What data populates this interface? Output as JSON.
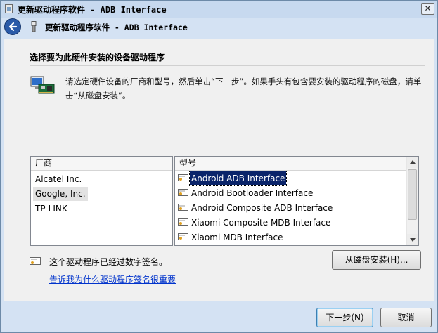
{
  "window": {
    "title": "更新驱动程序软件 - ADB Interface",
    "close_label": "✕"
  },
  "header": {
    "title": "更新驱动程序软件 - ADB Interface"
  },
  "content": {
    "heading": "选择要为此硬件安装的设备驱动程序",
    "instruction": "请选定硬件设备的厂商和型号，然后单击“下一步”。如果手头有包含要安装的驱动程序的磁盘，请单击“从磁盘安装”。"
  },
  "vendors": {
    "header": "厂商",
    "items": [
      "Alcatel Inc.",
      "Google, Inc.",
      "TP-LINK"
    ],
    "selected_index": 1
  },
  "models": {
    "header": "型号",
    "items": [
      "Android ADB Interface",
      "Android Bootloader Interface",
      "Android Composite ADB Interface",
      "Xiaomi Composite MDB Interface",
      "Xiaomi MDB Interface"
    ],
    "selected_index": 0
  },
  "signature": {
    "text": "这个驱动程序已经过数字签名。",
    "link": "告诉我为什么驱动程序签名很重要"
  },
  "buttons": {
    "have_disk": "从磁盘安装(H)...",
    "next": "下一步(N)",
    "cancel": "取消"
  },
  "colors": {
    "accent": "#2a5aa8",
    "selection": "#0a246a",
    "link": "#0033cc",
    "frame": "#d4e2f3"
  }
}
